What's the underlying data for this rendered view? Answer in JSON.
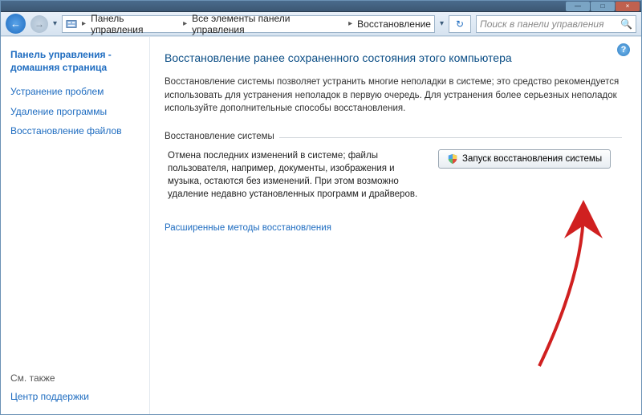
{
  "titlebar": {
    "min": "—",
    "max": "□",
    "close": "×"
  },
  "nav": {
    "back": "←",
    "fwd": "→",
    "dropdown": "▾",
    "refresh": "↻"
  },
  "breadcrumb": {
    "cp": "Панель управления",
    "all": "Все элементы панели управления",
    "recovery": "Восстановление"
  },
  "search": {
    "placeholder": "Поиск в панели управления"
  },
  "sidebar": {
    "home": "Панель управления - домашняя страница",
    "troubleshoot": "Устранение проблем",
    "uninstall": "Удаление программы",
    "filerecovery": "Восстановление файлов",
    "seealso": "См. также",
    "support": "Центр поддержки"
  },
  "main": {
    "heading": "Восстановление ранее сохраненного состояния этого компьютера",
    "intro": "Восстановление системы позволяет устранить многие неполадки в системе; это средство рекомендуется использовать для устранения неполадок в первую очередь. Для устранения более серьезных неполадок используйте дополнительные способы восстановления.",
    "group_label": "Восстановление системы",
    "group_desc": "Отмена последних изменений в системе; файлы пользователя, например, документы, изображения и музыка, остаются без изменений. При этом возможно удаление недавно установленных программ и драйверов.",
    "button": "Запуск восстановления системы",
    "advanced": "Расширенные методы восстановления"
  },
  "help": "?"
}
